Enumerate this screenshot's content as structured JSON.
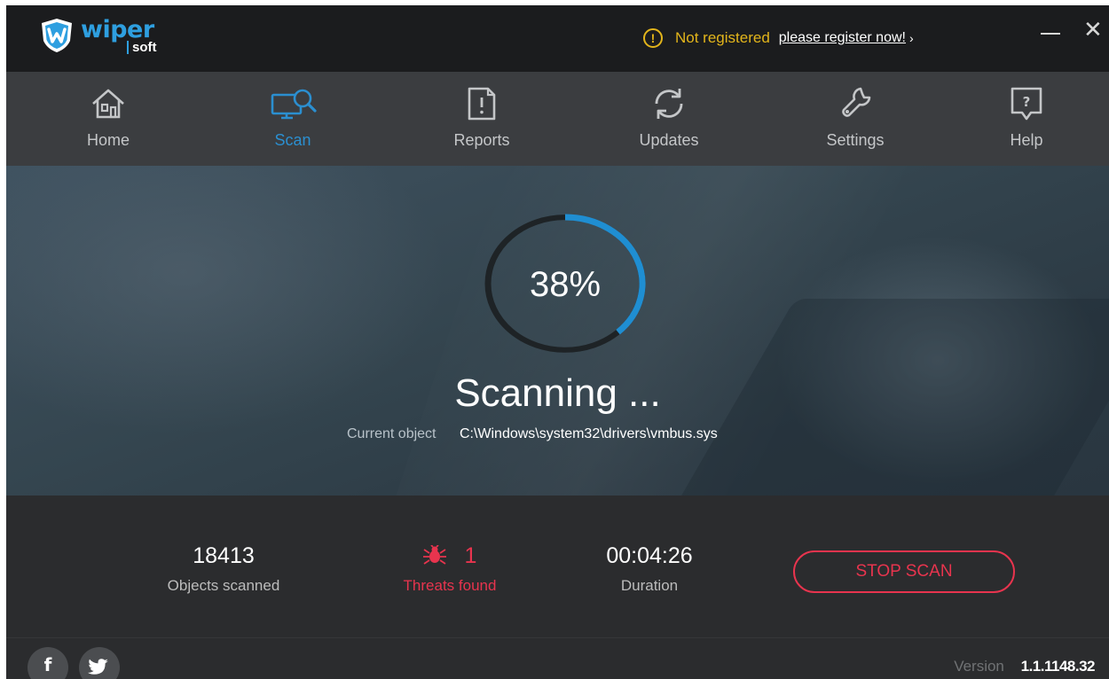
{
  "app": {
    "logo_primary": "wiper",
    "logo_secondary": "soft"
  },
  "registration": {
    "icon": "alert-circle-icon",
    "status": "Not registered",
    "link": "please register now!",
    "chevron": "›"
  },
  "window_controls": {
    "minimize": "",
    "close": "✕"
  },
  "nav": {
    "items": [
      {
        "label": "Home",
        "icon": "home-icon",
        "active": false
      },
      {
        "label": "Scan",
        "icon": "scan-icon",
        "active": true
      },
      {
        "label": "Reports",
        "icon": "reports-icon",
        "active": false
      },
      {
        "label": "Updates",
        "icon": "refresh-icon",
        "active": false
      },
      {
        "label": "Settings",
        "icon": "wrench-icon",
        "active": false
      },
      {
        "label": "Help",
        "icon": "help-icon",
        "active": false
      }
    ]
  },
  "scan": {
    "progress": 0.38,
    "percent_label": "38%",
    "status": "Scanning ...",
    "current_label": "Current object",
    "current_path": "C:\\Windows\\system32\\drivers\\vmbus.sys"
  },
  "stats": {
    "objects_value": "18413",
    "objects_label": "Objects scanned",
    "threats_value": "1",
    "threats_label": "Threats found",
    "duration_value": "00:04:26",
    "duration_label": "Duration"
  },
  "actions": {
    "stop_label": "STOP SCAN"
  },
  "footer": {
    "facebook": "f",
    "version_label": "Version",
    "version_value": "1.1.1148.32"
  },
  "colors": {
    "accent": "#2b8fd0",
    "warning": "#e3b51b",
    "danger": "#e8344e",
    "ring_track": "#1e2326"
  }
}
